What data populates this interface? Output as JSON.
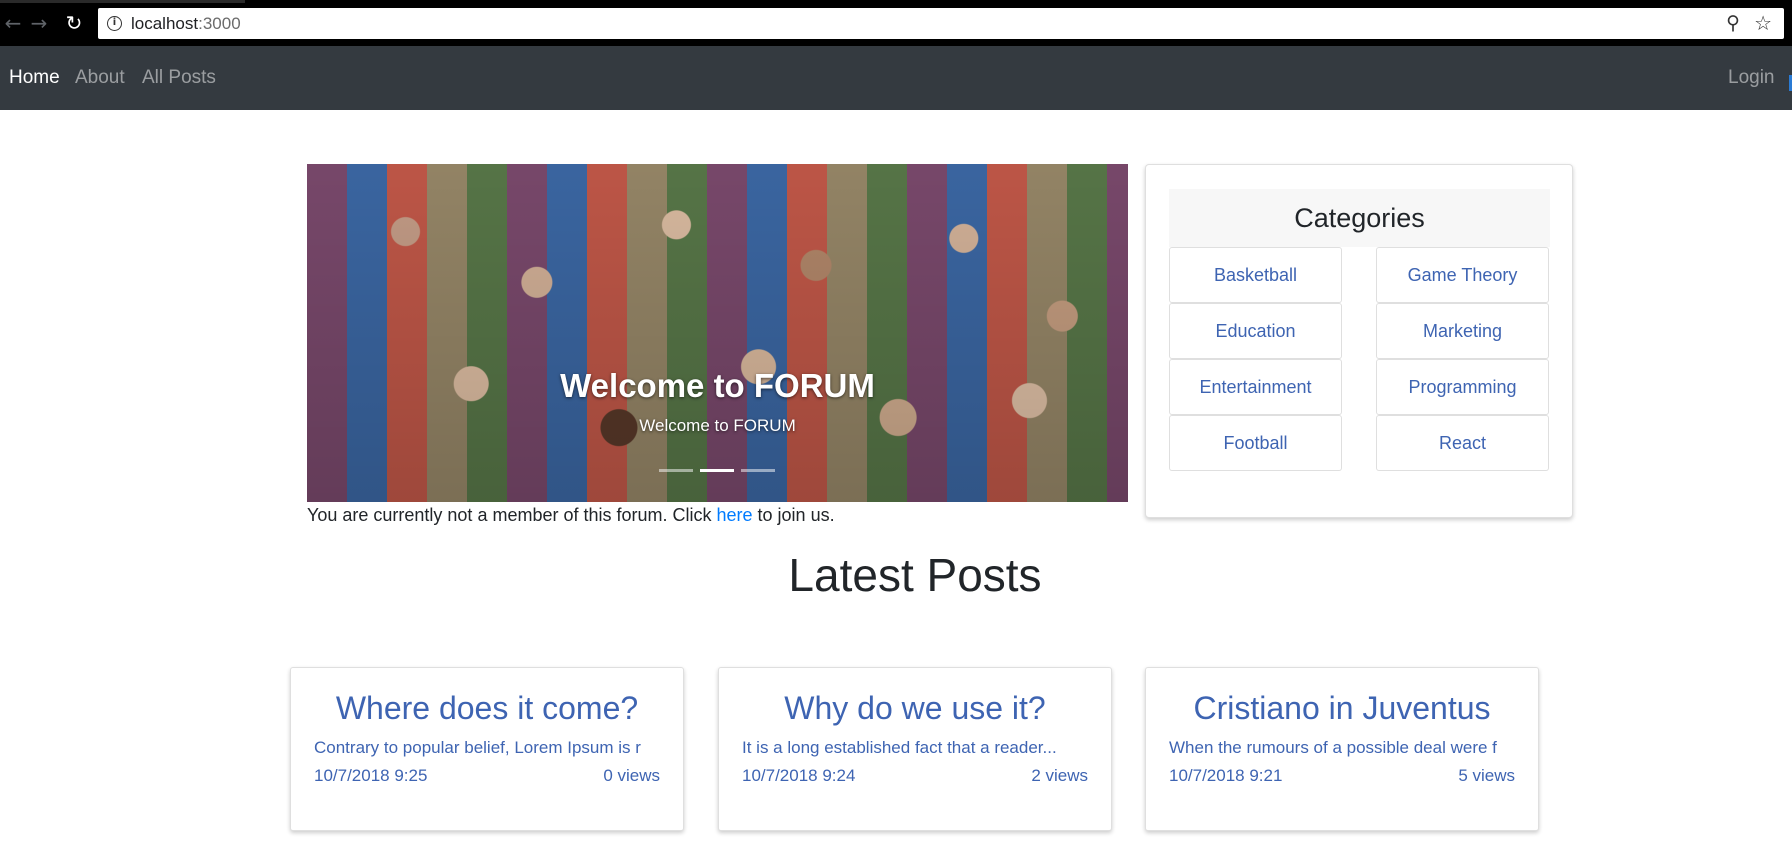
{
  "browser": {
    "url_host": "localhost",
    "url_port": ":3000"
  },
  "navbar": {
    "home": "Home",
    "about": "About",
    "all_posts": "All Posts",
    "login": "Login"
  },
  "carousel": {
    "caption_title": "Welcome to FORUM",
    "caption_text": "Welcome to FORUM",
    "active_slide": 2,
    "slide_count": 3
  },
  "membership": {
    "prefix": "You are currently not a member of this forum. Click ",
    "link": "here",
    "suffix": " to join us."
  },
  "categories": {
    "title": "Categories",
    "items": [
      "Basketball",
      "Game Theory",
      "Education",
      "Marketing",
      "Entertainment",
      "Programming",
      "Football",
      "React"
    ]
  },
  "latest": {
    "title": "Latest Posts",
    "posts": [
      {
        "title": "Where does it come?",
        "excerpt": "Contrary to popular belief, Lorem Ipsum is r",
        "date": "10/7/2018 9:25",
        "views": "0 views"
      },
      {
        "title": "Why do we use it?",
        "excerpt": "It is a long established fact that a reader...",
        "date": "10/7/2018 9:24",
        "views": "2 views"
      },
      {
        "title": "Cristiano in Juventus",
        "excerpt": "When the rumours of a possible deal were f",
        "date": "10/7/2018 9:21",
        "views": "5 views"
      }
    ]
  },
  "colors": {
    "navbar_bg": "#343a40",
    "link_blue": "#3e64b2",
    "accent": "#007bff"
  }
}
